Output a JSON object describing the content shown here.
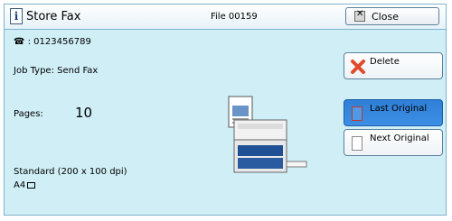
{
  "header": {
    "title": "Store Fax",
    "file_name": "File 00159",
    "close_label": "Close"
  },
  "fax_number": "☎ : 0123456789",
  "job_type": "Job Type: Send Fax",
  "pages": {
    "label": "Pages:",
    "value": "10"
  },
  "resolution": "Standard (200 x 100 dpi)",
  "paper_size": "A4",
  "buttons": {
    "delete": "Delete",
    "last_original": "Last Original",
    "next_original": "Next Original"
  },
  "colors": {
    "panel_bg": "#cfeef6",
    "selected_button": "#3c8fe4",
    "delete_icon": "#e04a2a"
  }
}
